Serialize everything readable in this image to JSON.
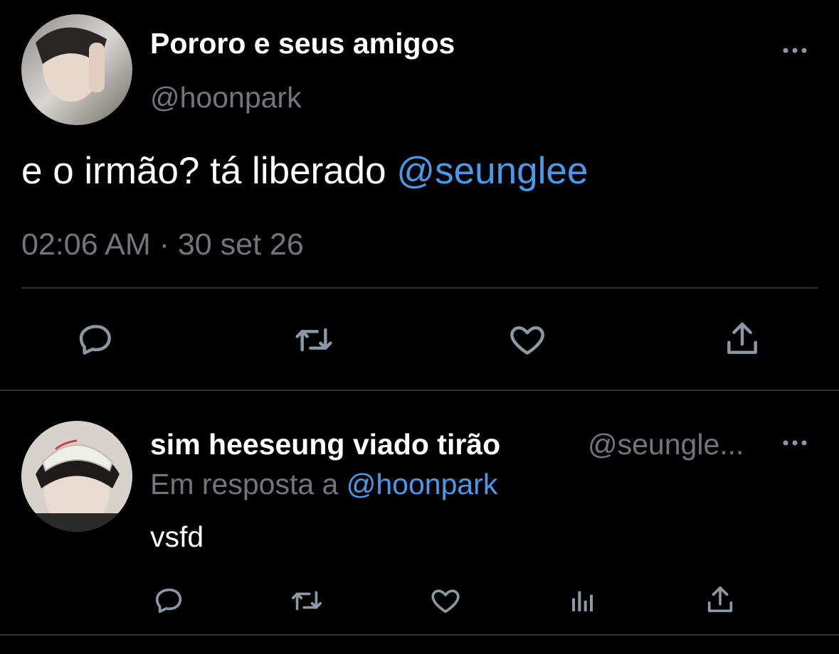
{
  "main_tweet": {
    "display_name": "Pororo e seus amigos",
    "handle": "@hoonpark",
    "text": "e o irmão? tá liberado ",
    "mention": "@seunglee",
    "timestamp": "02:06 AM · 30 set 26",
    "actions": [
      "reply-icon",
      "retweet-icon",
      "like-icon",
      "share-icon"
    ],
    "more_icon": "more-dots-icon"
  },
  "reply_tweet": {
    "display_name": "sim heeseung viado tirão",
    "handle": "@seungle...",
    "reply_prefix": "Em resposta a ",
    "reply_to": "@hoonpark",
    "text": "vsfd",
    "actions": [
      "reply-icon",
      "retweet-icon",
      "like-icon",
      "analytics-icon",
      "share-icon"
    ],
    "more_icon": "more-dots-icon"
  },
  "colors": {
    "background": "#000000",
    "text": "#e7e9ea",
    "secondary": "#71767b",
    "link": "#4a99e9",
    "divider": "#2f3336"
  }
}
